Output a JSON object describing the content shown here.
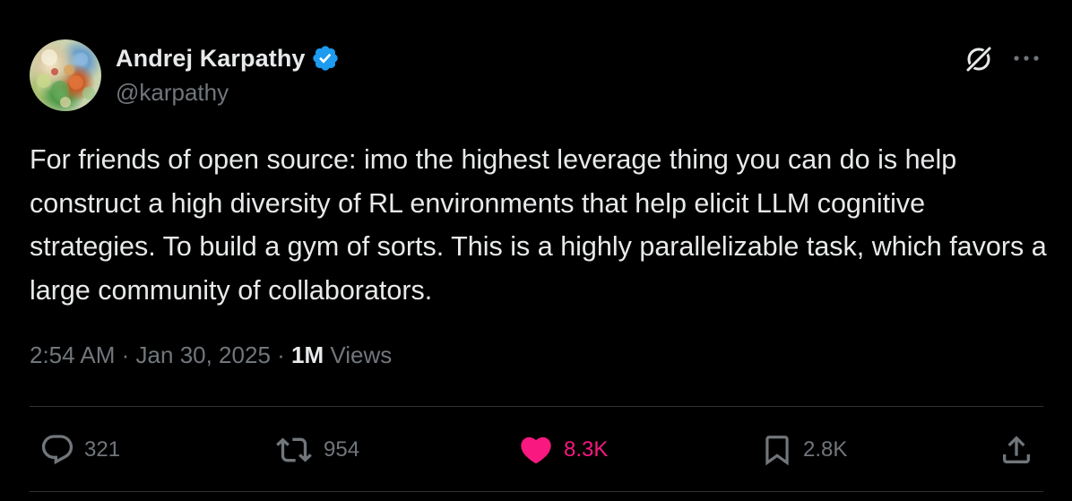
{
  "author": {
    "display_name": "Andrej Karpathy",
    "handle": "@karpathy",
    "verified": true,
    "verified_color": "#1d9bf0"
  },
  "header_icons": {
    "grok": "grok-icon",
    "more": "more-icon"
  },
  "tweet": {
    "text": "For friends of open source: imo the highest leverage thing you can do is help construct a high diversity of RL environments that help elicit LLM cognitive strategies. To build a gym of sorts. This is a highly parallelizable task, which favors a large community of collaborators."
  },
  "meta": {
    "time": "2:54 AM",
    "separator": "·",
    "date": "Jan 30, 2025",
    "views_count": "1M",
    "views_label": "Views"
  },
  "actions": {
    "replies": "321",
    "reposts": "954",
    "likes": "8.3K",
    "bookmarks": "2.8K",
    "like_color": "#f91880",
    "muted_color": "#71767b"
  }
}
